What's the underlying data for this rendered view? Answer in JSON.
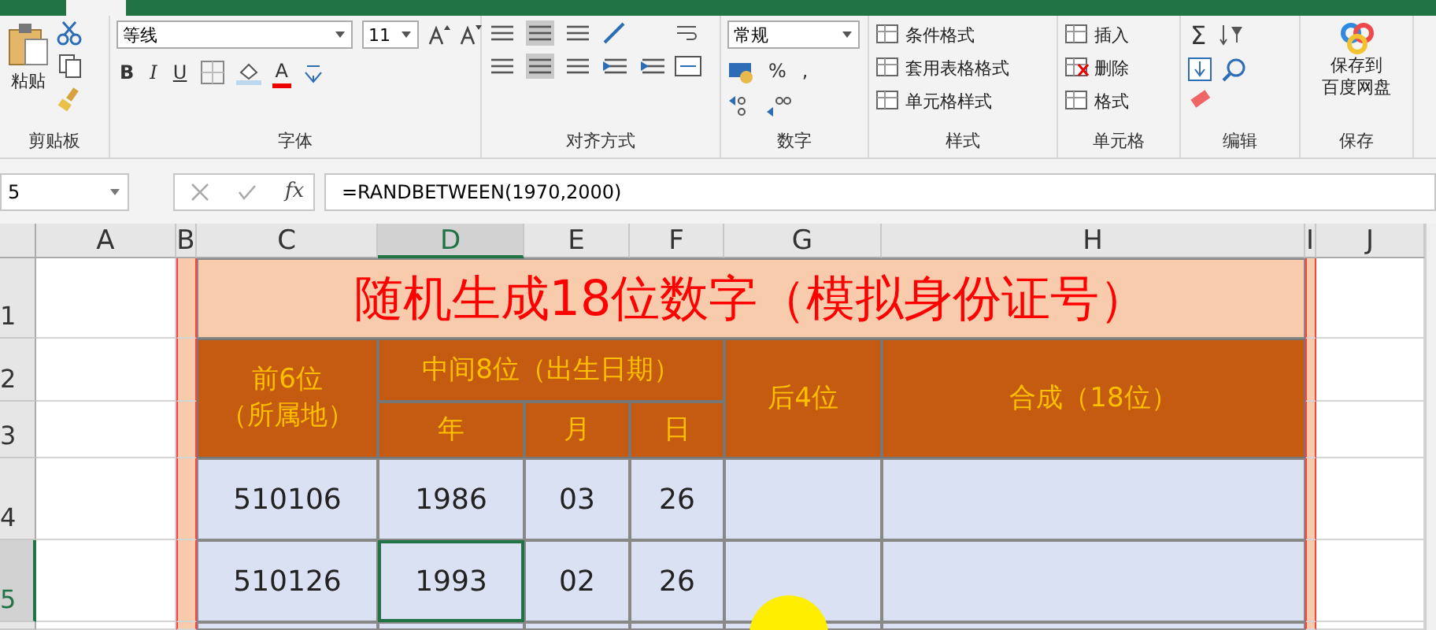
{
  "ribbon": {
    "groups": [
      {
        "kind": "clipboard",
        "label": "剪贴板",
        "paste": "粘贴"
      },
      {
        "kind": "font",
        "label": "字体",
        "font_name": "等线",
        "font_size": "11",
        "bold": "B",
        "italic": "I",
        "underline": "U",
        "font_color": "A"
      },
      {
        "kind": "alignment",
        "label": "对齐方式"
      },
      {
        "kind": "number",
        "label": "数字",
        "format": "常规",
        "percent": "%",
        "comma": ","
      },
      {
        "kind": "styles",
        "label": "样式",
        "items": [
          "条件格式",
          "套用表格格式",
          "单元格样式"
        ]
      },
      {
        "kind": "cells",
        "label": "单元格",
        "items": [
          "插入",
          "删除",
          "格式"
        ]
      },
      {
        "kind": "editing",
        "label": "编辑",
        "sum": "Σ"
      },
      {
        "kind": "save",
        "label": "保存",
        "button_lines": [
          "保存到",
          "百度网盘"
        ]
      }
    ]
  },
  "formula_bar": {
    "name_box": "5",
    "fx": "fx",
    "formula": "=RANDBETWEEN(1970,2000)"
  },
  "columns": [
    {
      "label": "A",
      "selected": false
    },
    {
      "label": "B",
      "selected": false
    },
    {
      "label": "C",
      "selected": false
    },
    {
      "label": "D",
      "selected": true
    },
    {
      "label": "E",
      "selected": false
    },
    {
      "label": "F",
      "selected": false
    },
    {
      "label": "G",
      "selected": false
    },
    {
      "label": "H",
      "selected": false
    },
    {
      "label": "I",
      "selected": false
    },
    {
      "label": "J",
      "selected": false
    }
  ],
  "row_numbers": [
    {
      "label": "1",
      "selected": false
    },
    {
      "label": "2",
      "selected": false
    },
    {
      "label": "3",
      "selected": false
    },
    {
      "label": "4",
      "selected": false
    },
    {
      "label": "5",
      "selected": true
    }
  ],
  "table": {
    "title": "随机生成18位数字（模拟身份证号）",
    "headers": [
      {
        "label_lines": [
          "前6位",
          "（所属地）"
        ]
      },
      {
        "label": "中间8位（出生日期）",
        "children": [
          {
            "label": "年"
          },
          {
            "label": "月"
          },
          {
            "label": "日"
          }
        ]
      },
      {
        "label": "后4位"
      },
      {
        "label": "合成（18位）"
      }
    ],
    "rows": [
      {
        "cells": [
          {
            "text": "510106",
            "selected": false
          },
          {
            "text": "1986",
            "selected": false
          },
          {
            "text": "03",
            "selected": false
          },
          {
            "text": "26",
            "selected": false
          }
        ]
      },
      {
        "cells": [
          {
            "text": "510126",
            "selected": false
          },
          {
            "text": "1993",
            "selected": true
          },
          {
            "text": "02",
            "selected": false
          },
          {
            "text": "26",
            "selected": false
          }
        ]
      }
    ]
  }
}
